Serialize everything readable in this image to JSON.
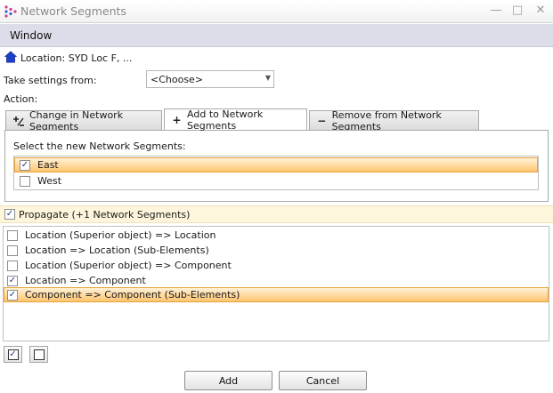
{
  "window": {
    "title": "Network Segments",
    "controls": {
      "minimize": "—",
      "maximize": "□",
      "close": "✕"
    }
  },
  "menu": {
    "window_label": "Window"
  },
  "location": {
    "text": "Location: SYD Loc F, ..."
  },
  "settings": {
    "label": "Take settings from:",
    "selected": "<Choose>"
  },
  "action": {
    "label": "Action:"
  },
  "tabs": [
    {
      "label": "Change in Network Segments",
      "icon": "change-icon",
      "active": false
    },
    {
      "label": "Add to Network Segments",
      "icon": "plus-icon",
      "active": true
    },
    {
      "label": "Remove from Network Segments",
      "icon": "minus-icon",
      "active": false
    }
  ],
  "segments_panel": {
    "caption": "Select the new Network Segments:",
    "items": [
      {
        "label": "East",
        "checked": true,
        "selected": true
      },
      {
        "label": "West",
        "checked": false,
        "selected": false
      }
    ]
  },
  "propagate": {
    "label": "Propagate (+1 Network Segments)",
    "checked": true
  },
  "propagation_rules": [
    {
      "label": "Location (Superior object) => Location",
      "checked": false,
      "selected": false
    },
    {
      "label": "Location => Location (Sub-Elements)",
      "checked": false,
      "selected": false
    },
    {
      "label": "Location (Superior object) => Component",
      "checked": false,
      "selected": false
    },
    {
      "label": "Location => Component",
      "checked": true,
      "selected": false
    },
    {
      "label": "Component => Component (Sub-Elements)",
      "checked": true,
      "selected": true
    }
  ],
  "buttons": {
    "add": "Add",
    "cancel": "Cancel"
  },
  "colors": {
    "accent": "#ffc46e",
    "menu_bg": "#dddde9",
    "propagate_bg": "#fdf6dc",
    "location_icon": "#1c3fc4"
  }
}
